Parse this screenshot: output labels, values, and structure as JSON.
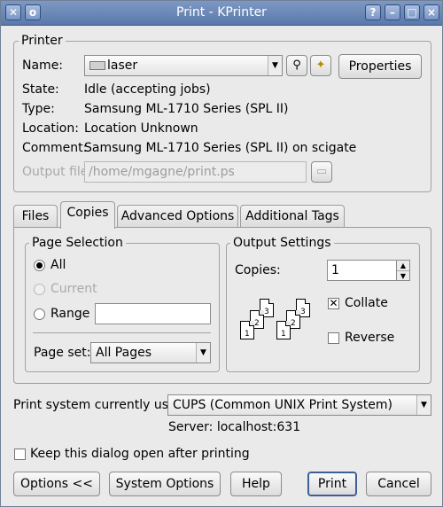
{
  "window": {
    "title": "Print - KPrinter",
    "buttons": [
      "?",
      "–",
      "□",
      "×"
    ]
  },
  "printer_group": {
    "title": "Printer",
    "name_label": "Name:",
    "name_value": "laser",
    "properties_label": "Properties",
    "rows": [
      {
        "label": "State:",
        "value": "Idle (accepting jobs)"
      },
      {
        "label": "Type:",
        "value": "Samsung ML-1710 Series (SPL II)"
      },
      {
        "label": "Location:",
        "value": "Location Unknown"
      },
      {
        "label": "Comment:",
        "value": "Samsung ML-1710 Series (SPL II) on scigate"
      }
    ],
    "output_file_label": "Output file:",
    "output_file_value": "/home/mgagne/print.ps"
  },
  "tabs": [
    {
      "label": "Files"
    },
    {
      "label": "Copies"
    },
    {
      "label": "Advanced Options"
    },
    {
      "label": "Additional Tags"
    }
  ],
  "page_selection": {
    "title": "Page Selection",
    "all_label": "All",
    "current_label": "Current",
    "range_label": "Range",
    "range_value": "",
    "page_set_label": "Page set:",
    "page_set_value": "All Pages",
    "selected": "All"
  },
  "output_settings": {
    "title": "Output Settings",
    "copies_label": "Copies:",
    "copies_value": "1",
    "collate_label": "Collate",
    "collate_checked": true,
    "reverse_label": "Reverse",
    "reverse_checked": false
  },
  "print_system": {
    "label": "Print system currently used:",
    "value": "CUPS (Common UNIX Print System)",
    "server": "Server: localhost:631"
  },
  "keep_open": {
    "label": "Keep this dialog open after printing",
    "checked": false
  },
  "buttons": {
    "options": "Options <<",
    "system_options": "System Options",
    "help": "Help",
    "print": "Print",
    "cancel": "Cancel"
  }
}
